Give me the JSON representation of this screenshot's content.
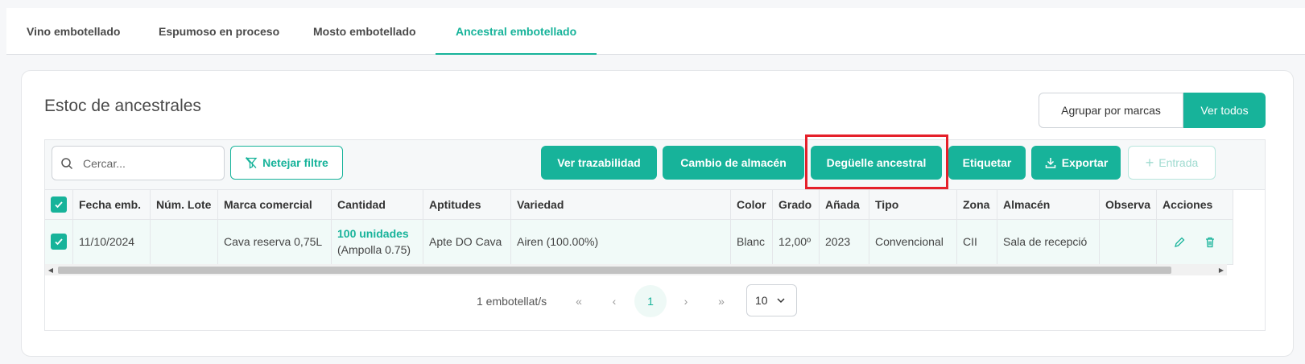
{
  "tabs": [
    {
      "label": "Vino embotellado",
      "active": false
    },
    {
      "label": "Espumoso en proceso",
      "active": false
    },
    {
      "label": "Mosto embotellado",
      "active": false
    },
    {
      "label": "Ancestral embotellado",
      "active": true
    }
  ],
  "card": {
    "title": "Estoc de ancestrales",
    "group_label": "Agrupar por marcas",
    "view_all_label": "Ver todos"
  },
  "toolbar": {
    "search_placeholder": "Cercar...",
    "clear_filter_label": "Netejar filtre",
    "traceability_label": "Ver trazabilidad",
    "change_warehouse_label": "Cambio de almacén",
    "disgorge_label": "Degüelle ancestral",
    "label_label": "Etiquetar",
    "export_label": "Exportar",
    "entry_label": "Entrada"
  },
  "table": {
    "headers": [
      "Fecha emb.",
      "Núm. Lote",
      "Marca comercial",
      "Cantidad",
      "Aptitudes",
      "Variedad",
      "Color",
      "Grado",
      "Añada",
      "Tipo",
      "Zona",
      "Almacén",
      "Observa",
      "Acciones"
    ],
    "rows": [
      {
        "fecha": "11/10/2024",
        "lote": "",
        "marca": "Cava reserva 0,75L",
        "cantidad": "100 unidades",
        "cantidad_sub": "(Ampolla 0.75)",
        "aptitudes": "Apte DO Cava",
        "variedad": "Airen (100.00%)",
        "color": "Blanc",
        "grado": "12,00º",
        "anada": "2023",
        "tipo": "Convencional",
        "zona": "CII",
        "almacen": "Sala de recepció",
        "observaciones": ""
      }
    ]
  },
  "pagination": {
    "summary": "1 embotellat/s",
    "current_page": "1",
    "first": "«",
    "prev": "‹",
    "next": "›",
    "last": "»",
    "page_size": "10"
  },
  "colors": {
    "accent": "#17b39a",
    "highlight": "#e5202a"
  }
}
